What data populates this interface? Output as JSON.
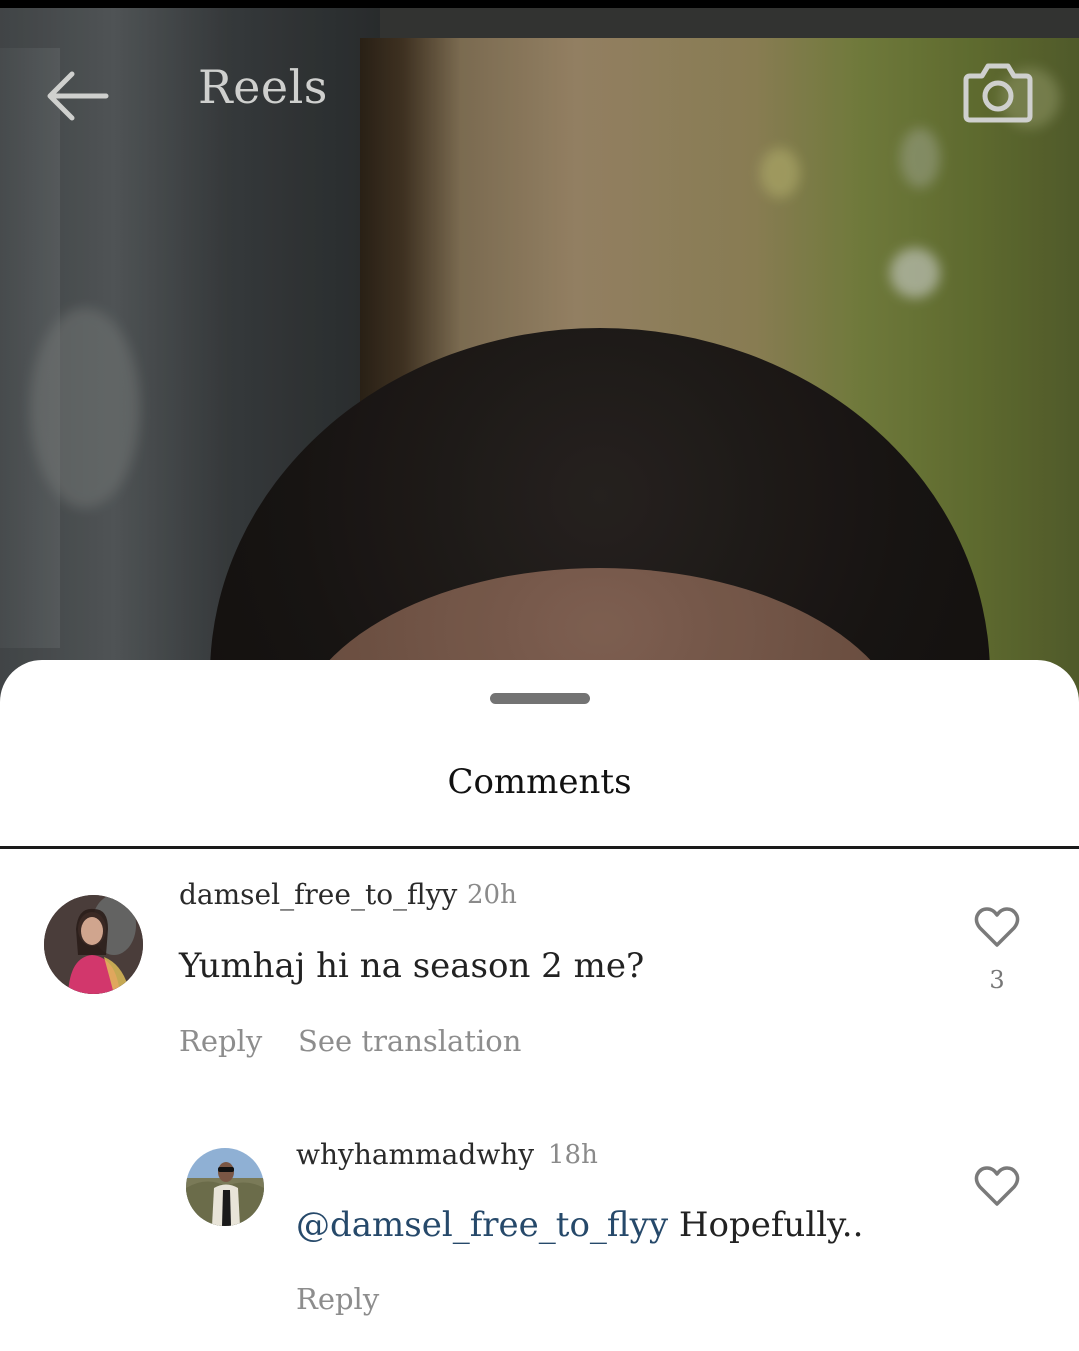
{
  "header": {
    "title": "Reels",
    "back_icon": "arrow-left-icon",
    "camera_icon": "camera-icon",
    "title_color": "#cfd0ce"
  },
  "sheet": {
    "title": "Comments"
  },
  "comments": [
    {
      "username": "damsel_free_to_flyy",
      "time": "20h",
      "text": "Yumhaj hi na season 2 me?",
      "likes": "3",
      "actions": [
        "Reply",
        "See translation"
      ]
    }
  ],
  "replies": [
    {
      "username": "whyhammadwhy",
      "time": "18h",
      "mention": "@damsel_free_to_flyy",
      "text": " Hopefully..",
      "actions": [
        "Reply"
      ]
    }
  ],
  "colors": {
    "mention": "#26496a",
    "secondary_text": "#8d8d8d",
    "handle": "#737373"
  }
}
